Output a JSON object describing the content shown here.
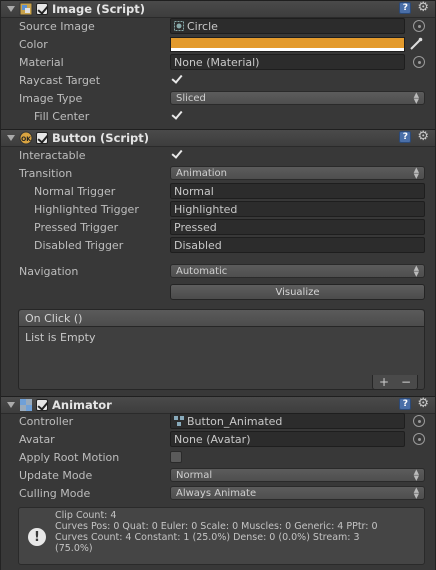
{
  "image_component": {
    "title": "Image (Script)",
    "enabled": true,
    "fields": {
      "source_image": {
        "label": "Source Image",
        "value": "Circle"
      },
      "color": {
        "label": "Color",
        "value": "#e39a2c"
      },
      "material": {
        "label": "Material",
        "value": "None (Material)"
      },
      "raycast_target": {
        "label": "Raycast Target",
        "checked": true
      },
      "image_type": {
        "label": "Image Type",
        "value": "Sliced"
      },
      "fill_center": {
        "label": "Fill Center",
        "checked": true
      }
    }
  },
  "button_component": {
    "title": "Button (Script)",
    "enabled": true,
    "fields": {
      "interactable": {
        "label": "Interactable",
        "checked": true
      },
      "transition": {
        "label": "Transition",
        "value": "Animation"
      },
      "normal_trigger": {
        "label": "Normal Trigger",
        "value": "Normal"
      },
      "highlighted_trigger": {
        "label": "Highlighted Trigger",
        "value": "Highlighted"
      },
      "pressed_trigger": {
        "label": "Pressed Trigger",
        "value": "Pressed"
      },
      "disabled_trigger": {
        "label": "Disabled Trigger",
        "value": "Disabled"
      },
      "navigation": {
        "label": "Navigation",
        "value": "Automatic"
      }
    },
    "visualize_label": "Visualize",
    "on_click": {
      "header": "On Click ()",
      "empty_text": "List is Empty",
      "add_label": "+",
      "remove_label": "−"
    }
  },
  "animator_component": {
    "title": "Animator",
    "enabled": true,
    "fields": {
      "controller": {
        "label": "Controller",
        "value": "Button_Animated"
      },
      "avatar": {
        "label": "Avatar",
        "value": "None (Avatar)"
      },
      "apply_root_motion": {
        "label": "Apply Root Motion",
        "checked": false
      },
      "update_mode": {
        "label": "Update Mode",
        "value": "Normal"
      },
      "culling_mode": {
        "label": "Culling Mode",
        "value": "Always Animate"
      }
    },
    "info": {
      "line1": "Clip Count: 4",
      "line2": "Curves Pos: 0 Quat: 0 Euler: 0 Scale: 0 Muscles: 0 Generic: 4 PPtr: 0",
      "line3": "Curves Count: 4 Constant: 1 (25.0%) Dense: 0 (0.0%) Stream: 3",
      "line4": "(75.0%)"
    }
  },
  "icons": {
    "help": "help-icon",
    "settings": "gear-icon",
    "object_picker": "object-picker-icon",
    "eyedropper": "eyedropper-icon",
    "info": "info-icon"
  }
}
